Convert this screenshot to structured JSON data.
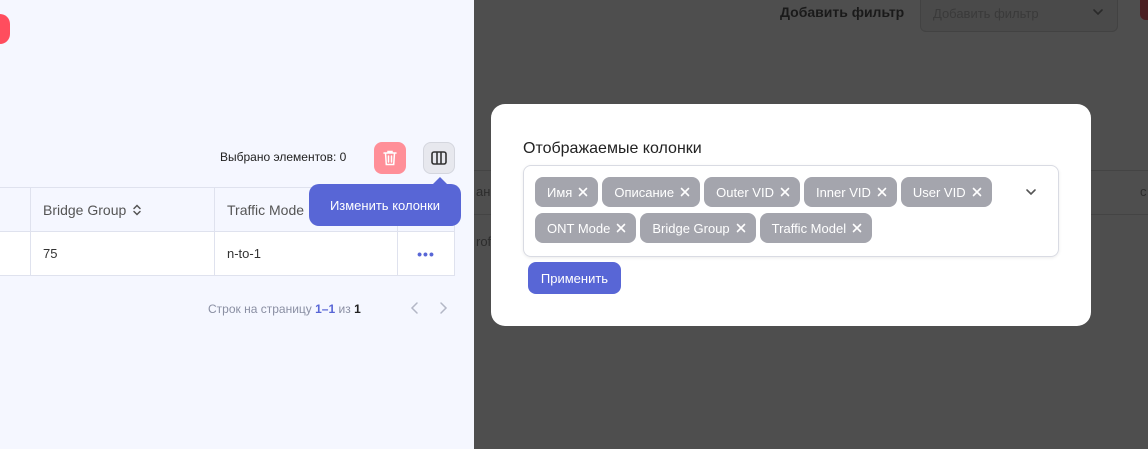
{
  "toolbar": {
    "selected_label": "Выбрано элементов: 0",
    "tooltip": "Изменить колонки"
  },
  "table": {
    "headers": [
      "Bridge Group",
      "Traffic Mode"
    ],
    "rows": [
      {
        "bridge_group": "75",
        "traffic_model": "n-to-1",
        "actions": "•••"
      }
    ]
  },
  "pagination": {
    "label": "Строк на страницу",
    "range": "1–1",
    "of": "из",
    "total": "1"
  },
  "filter": {
    "label": "Добавить фильтр",
    "placeholder": "Добавить фильтр"
  },
  "modal": {
    "title": "Отображаемые колонки",
    "chips": [
      "Имя",
      "Описание",
      "Outer VID",
      "Inner VID",
      "User VID",
      "ONT Mode",
      "Bridge Group",
      "Traffic Model"
    ],
    "apply_label": "Применить"
  },
  "background_fragments": [
    "ан",
    "rof",
    "c"
  ],
  "colors": {
    "accent": "#5866d6",
    "danger": "#ff4d5e",
    "chip": "#a4a5ad",
    "overlay": "#4e4e4e"
  },
  "icons": [
    "trash-icon",
    "columns-icon",
    "sort-icon",
    "chevron-left-icon",
    "chevron-right-icon",
    "chevron-down-icon",
    "close-icon"
  ]
}
